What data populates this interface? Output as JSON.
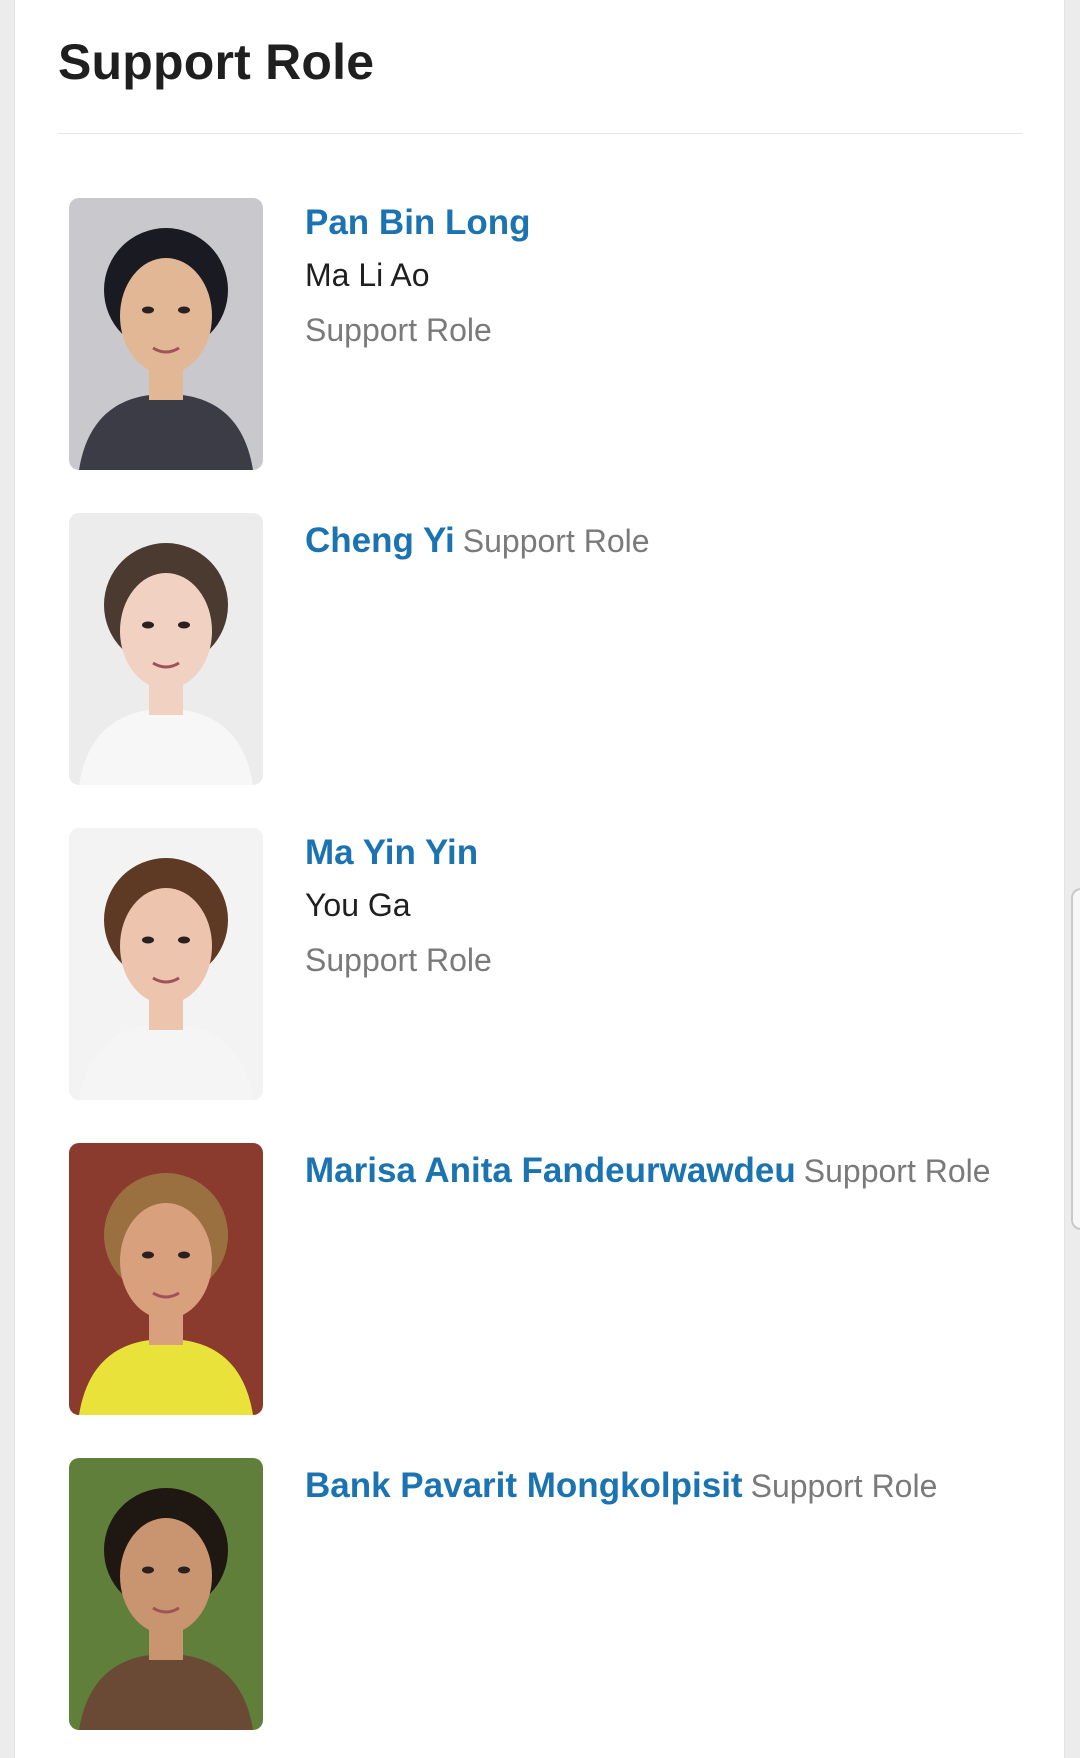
{
  "section": {
    "title": "Support Role"
  },
  "cast": [
    {
      "actor": "Pan Bin Long",
      "character": "Ma Li Ao",
      "role": "Support Role",
      "photo_bg": "#c9c9cd",
      "skin": "#e2b796",
      "hair": "#1a1a22",
      "clothes": "#3c3c46"
    },
    {
      "actor": "Cheng Yi",
      "character": "",
      "role": "Support Role",
      "photo_bg": "#ececec",
      "skin": "#f1d2c2",
      "hair": "#4a3a30",
      "clothes": "#f7f7f7"
    },
    {
      "actor": "Ma Yin Yin",
      "character": "You Ga",
      "role": "Support Role",
      "photo_bg": "#f3f3f3",
      "skin": "#edc5ae",
      "hair": "#5e3a24",
      "clothes": "#f5f5f5"
    },
    {
      "actor": "Marisa Anita Fandeurwawdeu",
      "character": "",
      "role": "Support Role",
      "photo_bg": "#8a3b2e",
      "skin": "#d9a07e",
      "hair": "#9b7040",
      "clothes": "#e8e23a"
    },
    {
      "actor": "Bank Pavarit Mongkolpisit",
      "character": "",
      "role": "Support Role",
      "photo_bg": "#5f7f3a",
      "skin": "#c99570",
      "hair": "#1f1712",
      "clothes": "#6a4a34"
    }
  ]
}
